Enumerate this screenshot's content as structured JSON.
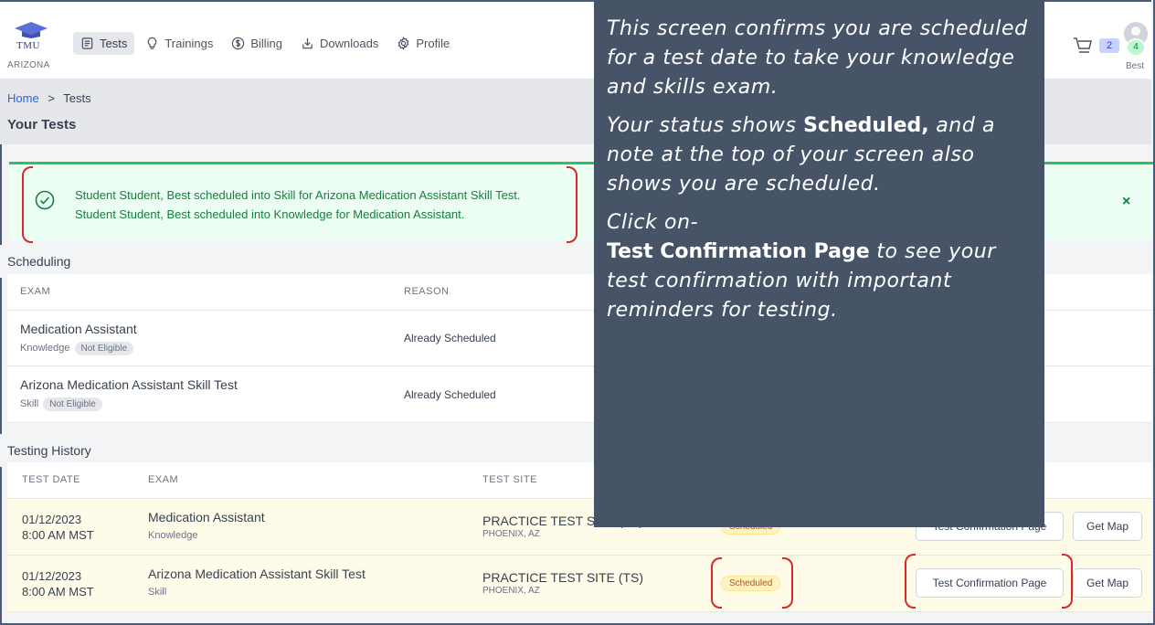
{
  "brand": {
    "name": "TMU",
    "state": "ARIZONA"
  },
  "nav": [
    {
      "label": "Tests",
      "icon": "tests-icon",
      "active": true
    },
    {
      "label": "Trainings",
      "icon": "lightbulb-icon"
    },
    {
      "label": "Billing",
      "icon": "dollar-icon"
    },
    {
      "label": "Downloads",
      "icon": "download-icon"
    },
    {
      "label": "Profile",
      "icon": "gear-icon"
    }
  ],
  "cart": {
    "count": "2"
  },
  "user": {
    "badge": "4",
    "name": "Best"
  },
  "breadcrumb": {
    "home": "Home",
    "separator": ">",
    "current": "Tests"
  },
  "page_title": "Your Tests",
  "alert": {
    "line1": "Student Student, Best scheduled into Skill for Arizona Medication Assistant Skill Test.",
    "line2": "Student Student, Best scheduled into Knowledge for Medication Assistant.",
    "close": "×"
  },
  "scheduling": {
    "title": "Scheduling",
    "headers": {
      "exam": "EXAM",
      "reason": "REASON"
    },
    "rows": [
      {
        "exam": "Medication Assistant",
        "type": "Knowledge",
        "eligibility": "Not Eligible",
        "reason": "Already Scheduled"
      },
      {
        "exam": "Arizona Medication Assistant Skill Test",
        "type": "Skill",
        "eligibility": "Not Eligible",
        "reason": "Already Scheduled"
      }
    ]
  },
  "history": {
    "title": "Testing History",
    "headers": {
      "date": "TEST DATE",
      "exam": "EXAM",
      "site": "TEST SITE"
    },
    "rows": [
      {
        "date": "01/12/2023",
        "time": "8:00 AM MST",
        "exam": "Medication Assistant",
        "type": "Knowledge",
        "site": "PRACTICE TEST SITE (TS)",
        "city": "PHOENIX, AZ",
        "status": "Scheduled",
        "confirm": "Test Confirmation Page",
        "map": "Get Map"
      },
      {
        "date": "01/12/2023",
        "time": "8:00 AM MST",
        "exam": "Arizona Medication Assistant Skill Test",
        "type": "Skill",
        "site": "PRACTICE TEST SITE (TS)",
        "city": "PHOENIX, AZ",
        "status": "Scheduled",
        "confirm": "Test Confirmation Page",
        "map": "Get Map"
      }
    ]
  },
  "tooltip": {
    "p1": "This screen confirms you are scheduled for a test date to take your knowledge and skills exam.",
    "p2a": "Your status shows ",
    "p2b": "Scheduled,",
    "p2c": " and a note at the top of your screen also shows you are scheduled.",
    "p3a": "Click on-",
    "p3b": "Test Confirmation Page",
    "p3c": " to see your test confirmation with important reminders for testing."
  },
  "colors": {
    "accent": "#2563eb",
    "success": "#22c55e",
    "annotation": "#dc2626",
    "tooltip_bg": "#475468"
  }
}
